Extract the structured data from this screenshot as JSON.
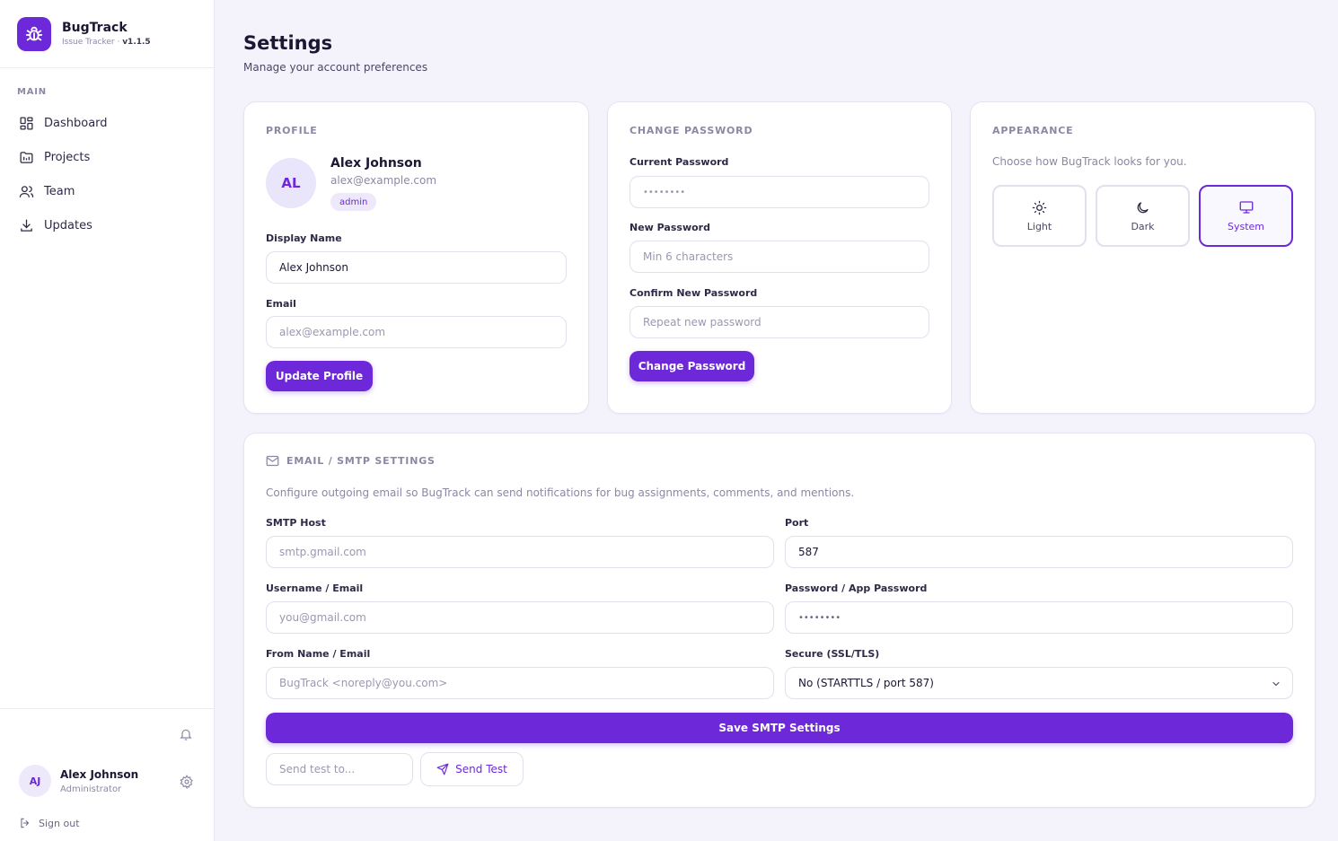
{
  "app": {
    "name": "BugTrack",
    "subtitle": "Issue Tracker · ",
    "version": "v1.1.5"
  },
  "sidebar": {
    "section_label": "MAIN",
    "items": [
      {
        "label": "Dashboard",
        "icon": "dashboard-icon"
      },
      {
        "label": "Projects",
        "icon": "projects-icon"
      },
      {
        "label": "Team",
        "icon": "team-icon"
      },
      {
        "label": "Updates",
        "icon": "download-icon"
      }
    ],
    "user": {
      "initials": "AJ",
      "name": "Alex Johnson",
      "role": "Administrator"
    },
    "signout_label": "Sign out"
  },
  "header": {
    "title": "Settings",
    "subtitle": "Manage your account preferences"
  },
  "profile": {
    "title": "PROFILE",
    "initials": "AL",
    "name": "Alex Johnson",
    "email": "alex@example.com",
    "role_badge": "admin",
    "display_name_label": "Display Name",
    "display_name_value": "Alex Johnson",
    "email_label": "Email",
    "email_value": "alex@example.com",
    "update_button": "Update Profile"
  },
  "password": {
    "title": "CHANGE PASSWORD",
    "current_label": "Current Password",
    "current_value": "••••••••",
    "new_label": "New Password",
    "new_placeholder": "Min 6 characters",
    "confirm_label": "Confirm New Password",
    "confirm_placeholder": "Repeat new password",
    "change_button": "Change Password"
  },
  "appearance": {
    "title": "APPEARANCE",
    "description": "Choose how BugTrack looks for you.",
    "options": [
      {
        "label": "Light",
        "icon": "sun-icon"
      },
      {
        "label": "Dark",
        "icon": "moon-icon"
      },
      {
        "label": "System",
        "icon": "monitor-icon"
      }
    ],
    "selected": "System"
  },
  "smtp": {
    "title": "EMAIL / SMTP SETTINGS",
    "description": "Configure outgoing email so BugTrack can send notifications for bug assignments, comments, and mentions.",
    "host_label": "SMTP Host",
    "host_placeholder": "smtp.gmail.com",
    "port_label": "Port",
    "port_value": "587",
    "username_label": "Username / Email",
    "username_placeholder": "you@gmail.com",
    "app_password_label": "Password / App Password",
    "app_password_value": "••••••••",
    "from_label": "From Name / Email",
    "from_placeholder": "BugTrack <noreply@you.com>",
    "secure_label": "Secure (SSL/TLS)",
    "secure_value": "No (STARTTLS / port 587)",
    "save_button": "Save SMTP Settings",
    "test_placeholder": "Send test to...",
    "send_test_button": "Send Test"
  },
  "colors": {
    "accent": "#6d28d9",
    "background": "#f4f3fc",
    "muted": "#8b88a3"
  }
}
